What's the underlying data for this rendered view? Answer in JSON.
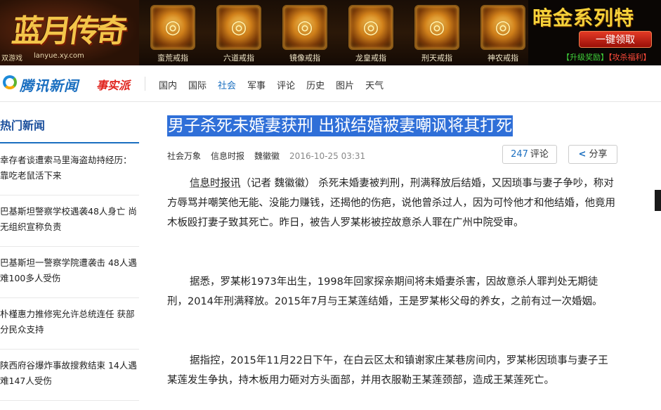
{
  "banner": {
    "logo_text": "蓝月传奇",
    "brand": "双游戏",
    "url": "lanyue.xy.com",
    "rings": [
      {
        "label": "蛮荒戒指",
        "icon": "ring-icon"
      },
      {
        "label": "六道戒指",
        "icon": "ring-icon"
      },
      {
        "label": "镜像戒指",
        "icon": "ring-icon"
      },
      {
        "label": "龙皇戒指",
        "icon": "ring-icon"
      },
      {
        "label": "刑天戒指",
        "icon": "ring-icon"
      },
      {
        "label": "神农戒指",
        "icon": "ring-icon"
      }
    ],
    "ad_title": "暗金系列特",
    "ad_button": "一键领取",
    "ad_link1": "【升级奖励】",
    "ad_link2": "【攻杀福利】"
  },
  "nav": {
    "logo": "腾讯新闻",
    "sub_logo": "事实派",
    "items": [
      "国内",
      "国际",
      "社会",
      "军事",
      "评论",
      "历史",
      "图片",
      "天气"
    ],
    "active": "社会"
  },
  "sidebar": {
    "title": "热门新闻",
    "items": [
      "幸存者谈遭索马里海盗劫持经历：靠吃老鼠活下来",
      "巴基斯坦警察学校遇袭48人身亡 尚无组织宣称负责",
      "巴基斯坦一警察学院遭袭击 48人遇难100多人受伤",
      "朴槿惠力推修宪允许总统连任 获部分民众支持",
      "陕西府谷爆炸事故搜救结束 14人遇难147人受伤"
    ]
  },
  "article": {
    "headline": "男子杀死未婚妻获刑 出狱结婚被妻嘲讽将其打死",
    "category": "社会万象",
    "source": "信息时报",
    "author": "魏徽徽",
    "time": "2016-10-25 03:31",
    "comment_count": "247",
    "comment_label": "评论",
    "share_label": "分享",
    "p1_source": "信息时报讯",
    "p1_rest": "（记者 魏徽徽） 杀死未婚妻被判刑，刑满释放后结婚，又因琐事与妻子争吵，称对方辱骂并嘲笑他无能、没能力赚钱，还揭他的伤疤，说他曾杀过人，因为可怜他才和他结婚，他竟用木板殴打妻子致其死亡。昨日，被告人罗某彬被控故意杀人罪在广州中院受审。",
    "p2": "据悉，罗某彬1973年出生，1998年回家探亲期间将未婚妻杀害，因故意杀人罪判处无期徒刑，2014年刑满释放。2015年7月与王某莲结婚，王是罗某彬父母的养女，之前有过一次婚姻。",
    "p3": "据指控，2015年11月22日下午，在白云区太和镇谢家庄某巷房间内，罗某彬因琐事与妻子王某莲发生争执，持木板用力砸对方头面部，并用衣服勒王某莲颈部，造成王某莲死亡。"
  },
  "colors": {
    "accent": "#1b6fc0",
    "highlight": "#2f6fd8",
    "brand_red": "#e0211b"
  }
}
